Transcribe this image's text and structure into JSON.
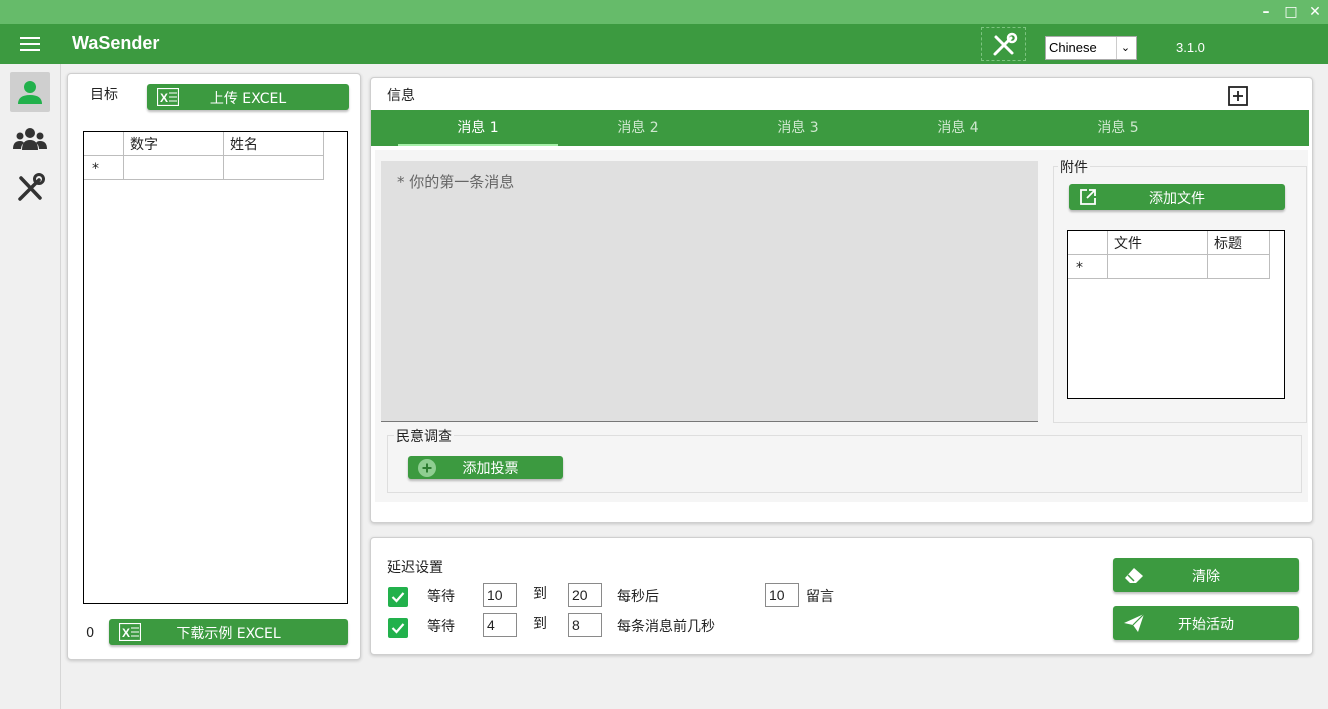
{
  "window": {
    "minimize_glyph": "–",
    "maximize_glyph": "□",
    "close_glyph": "✕"
  },
  "appbar": {
    "title": "WaSender",
    "language": "Chinese",
    "version": "3.1.0"
  },
  "sidebar": {
    "items": [
      {
        "name": "person-icon",
        "active": true
      },
      {
        "name": "group-icon",
        "active": false
      },
      {
        "name": "tools-icon",
        "active": false
      }
    ]
  },
  "targets": {
    "title": "目标",
    "upload_label": "上传 EXCEL",
    "columns": [
      "数字",
      "姓名"
    ],
    "new_row_marker": "*",
    "count": "0",
    "download_label": "下载示例 EXCEL"
  },
  "message": {
    "title": "信息",
    "tabs": [
      "消息 1",
      "消息 2",
      "消息 3",
      "消息 4",
      "消息 5"
    ],
    "active_tab": 0,
    "placeholder": "* 你的第一条消息",
    "attachments": {
      "title": "附件",
      "add_file_label": "添加文件",
      "columns": [
        "文件",
        "标题"
      ],
      "new_row_marker": "*"
    },
    "poll": {
      "title": "民意调查",
      "add_poll_label": "添加投票"
    }
  },
  "delay": {
    "title": "延迟设置",
    "row1": {
      "wait_label": "等待",
      "from": "10",
      "to_label": "到",
      "to": "20",
      "suffix": "每秒后",
      "count": "10",
      "count_suffix": "留言"
    },
    "row2": {
      "wait_label": "等待",
      "from": "4",
      "to_label": "到",
      "to": "8",
      "suffix": "每条消息前几秒"
    }
  },
  "actions": {
    "clear_label": "清除",
    "start_label": "开始活动"
  },
  "colors": {
    "primary": "#3c9a40",
    "titlebar": "#66bb6a",
    "checkbox": "#22b14c"
  }
}
